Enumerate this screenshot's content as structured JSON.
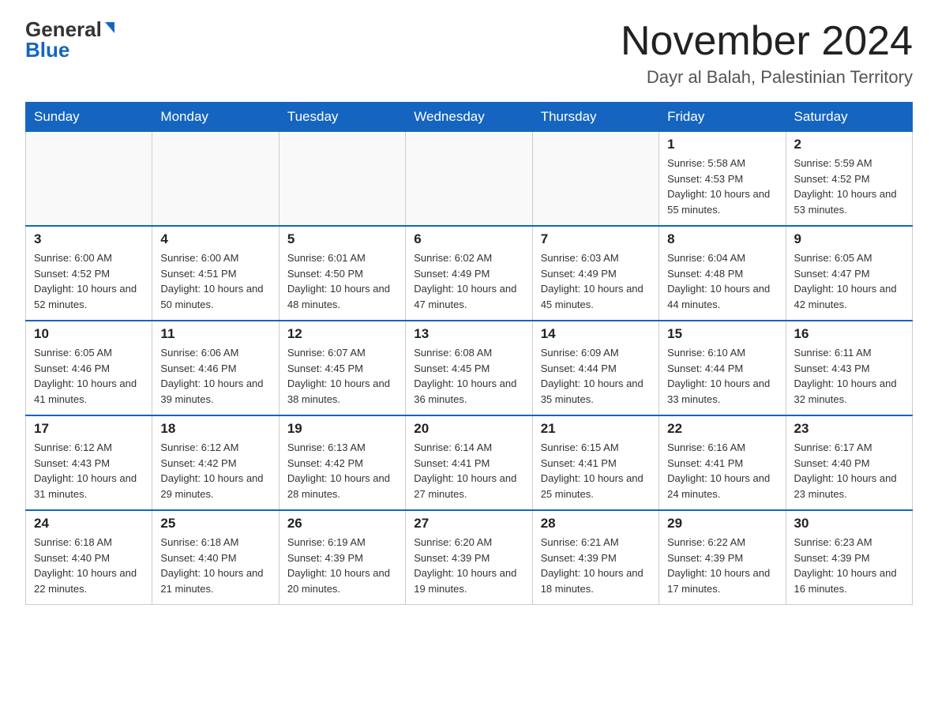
{
  "header": {
    "logo_general": "General",
    "logo_blue": "Blue",
    "title": "November 2024",
    "subtitle": "Dayr al Balah, Palestinian Territory"
  },
  "days_of_week": [
    "Sunday",
    "Monday",
    "Tuesday",
    "Wednesday",
    "Thursday",
    "Friday",
    "Saturday"
  ],
  "weeks": [
    [
      {
        "day": "",
        "info": ""
      },
      {
        "day": "",
        "info": ""
      },
      {
        "day": "",
        "info": ""
      },
      {
        "day": "",
        "info": ""
      },
      {
        "day": "",
        "info": ""
      },
      {
        "day": "1",
        "info": "Sunrise: 5:58 AM\nSunset: 4:53 PM\nDaylight: 10 hours and 55 minutes."
      },
      {
        "day": "2",
        "info": "Sunrise: 5:59 AM\nSunset: 4:52 PM\nDaylight: 10 hours and 53 minutes."
      }
    ],
    [
      {
        "day": "3",
        "info": "Sunrise: 6:00 AM\nSunset: 4:52 PM\nDaylight: 10 hours and 52 minutes."
      },
      {
        "day": "4",
        "info": "Sunrise: 6:00 AM\nSunset: 4:51 PM\nDaylight: 10 hours and 50 minutes."
      },
      {
        "day": "5",
        "info": "Sunrise: 6:01 AM\nSunset: 4:50 PM\nDaylight: 10 hours and 48 minutes."
      },
      {
        "day": "6",
        "info": "Sunrise: 6:02 AM\nSunset: 4:49 PM\nDaylight: 10 hours and 47 minutes."
      },
      {
        "day": "7",
        "info": "Sunrise: 6:03 AM\nSunset: 4:49 PM\nDaylight: 10 hours and 45 minutes."
      },
      {
        "day": "8",
        "info": "Sunrise: 6:04 AM\nSunset: 4:48 PM\nDaylight: 10 hours and 44 minutes."
      },
      {
        "day": "9",
        "info": "Sunrise: 6:05 AM\nSunset: 4:47 PM\nDaylight: 10 hours and 42 minutes."
      }
    ],
    [
      {
        "day": "10",
        "info": "Sunrise: 6:05 AM\nSunset: 4:46 PM\nDaylight: 10 hours and 41 minutes."
      },
      {
        "day": "11",
        "info": "Sunrise: 6:06 AM\nSunset: 4:46 PM\nDaylight: 10 hours and 39 minutes."
      },
      {
        "day": "12",
        "info": "Sunrise: 6:07 AM\nSunset: 4:45 PM\nDaylight: 10 hours and 38 minutes."
      },
      {
        "day": "13",
        "info": "Sunrise: 6:08 AM\nSunset: 4:45 PM\nDaylight: 10 hours and 36 minutes."
      },
      {
        "day": "14",
        "info": "Sunrise: 6:09 AM\nSunset: 4:44 PM\nDaylight: 10 hours and 35 minutes."
      },
      {
        "day": "15",
        "info": "Sunrise: 6:10 AM\nSunset: 4:44 PM\nDaylight: 10 hours and 33 minutes."
      },
      {
        "day": "16",
        "info": "Sunrise: 6:11 AM\nSunset: 4:43 PM\nDaylight: 10 hours and 32 minutes."
      }
    ],
    [
      {
        "day": "17",
        "info": "Sunrise: 6:12 AM\nSunset: 4:43 PM\nDaylight: 10 hours and 31 minutes."
      },
      {
        "day": "18",
        "info": "Sunrise: 6:12 AM\nSunset: 4:42 PM\nDaylight: 10 hours and 29 minutes."
      },
      {
        "day": "19",
        "info": "Sunrise: 6:13 AM\nSunset: 4:42 PM\nDaylight: 10 hours and 28 minutes."
      },
      {
        "day": "20",
        "info": "Sunrise: 6:14 AM\nSunset: 4:41 PM\nDaylight: 10 hours and 27 minutes."
      },
      {
        "day": "21",
        "info": "Sunrise: 6:15 AM\nSunset: 4:41 PM\nDaylight: 10 hours and 25 minutes."
      },
      {
        "day": "22",
        "info": "Sunrise: 6:16 AM\nSunset: 4:41 PM\nDaylight: 10 hours and 24 minutes."
      },
      {
        "day": "23",
        "info": "Sunrise: 6:17 AM\nSunset: 4:40 PM\nDaylight: 10 hours and 23 minutes."
      }
    ],
    [
      {
        "day": "24",
        "info": "Sunrise: 6:18 AM\nSunset: 4:40 PM\nDaylight: 10 hours and 22 minutes."
      },
      {
        "day": "25",
        "info": "Sunrise: 6:18 AM\nSunset: 4:40 PM\nDaylight: 10 hours and 21 minutes."
      },
      {
        "day": "26",
        "info": "Sunrise: 6:19 AM\nSunset: 4:39 PM\nDaylight: 10 hours and 20 minutes."
      },
      {
        "day": "27",
        "info": "Sunrise: 6:20 AM\nSunset: 4:39 PM\nDaylight: 10 hours and 19 minutes."
      },
      {
        "day": "28",
        "info": "Sunrise: 6:21 AM\nSunset: 4:39 PM\nDaylight: 10 hours and 18 minutes."
      },
      {
        "day": "29",
        "info": "Sunrise: 6:22 AM\nSunset: 4:39 PM\nDaylight: 10 hours and 17 minutes."
      },
      {
        "day": "30",
        "info": "Sunrise: 6:23 AM\nSunset: 4:39 PM\nDaylight: 10 hours and 16 minutes."
      }
    ]
  ]
}
